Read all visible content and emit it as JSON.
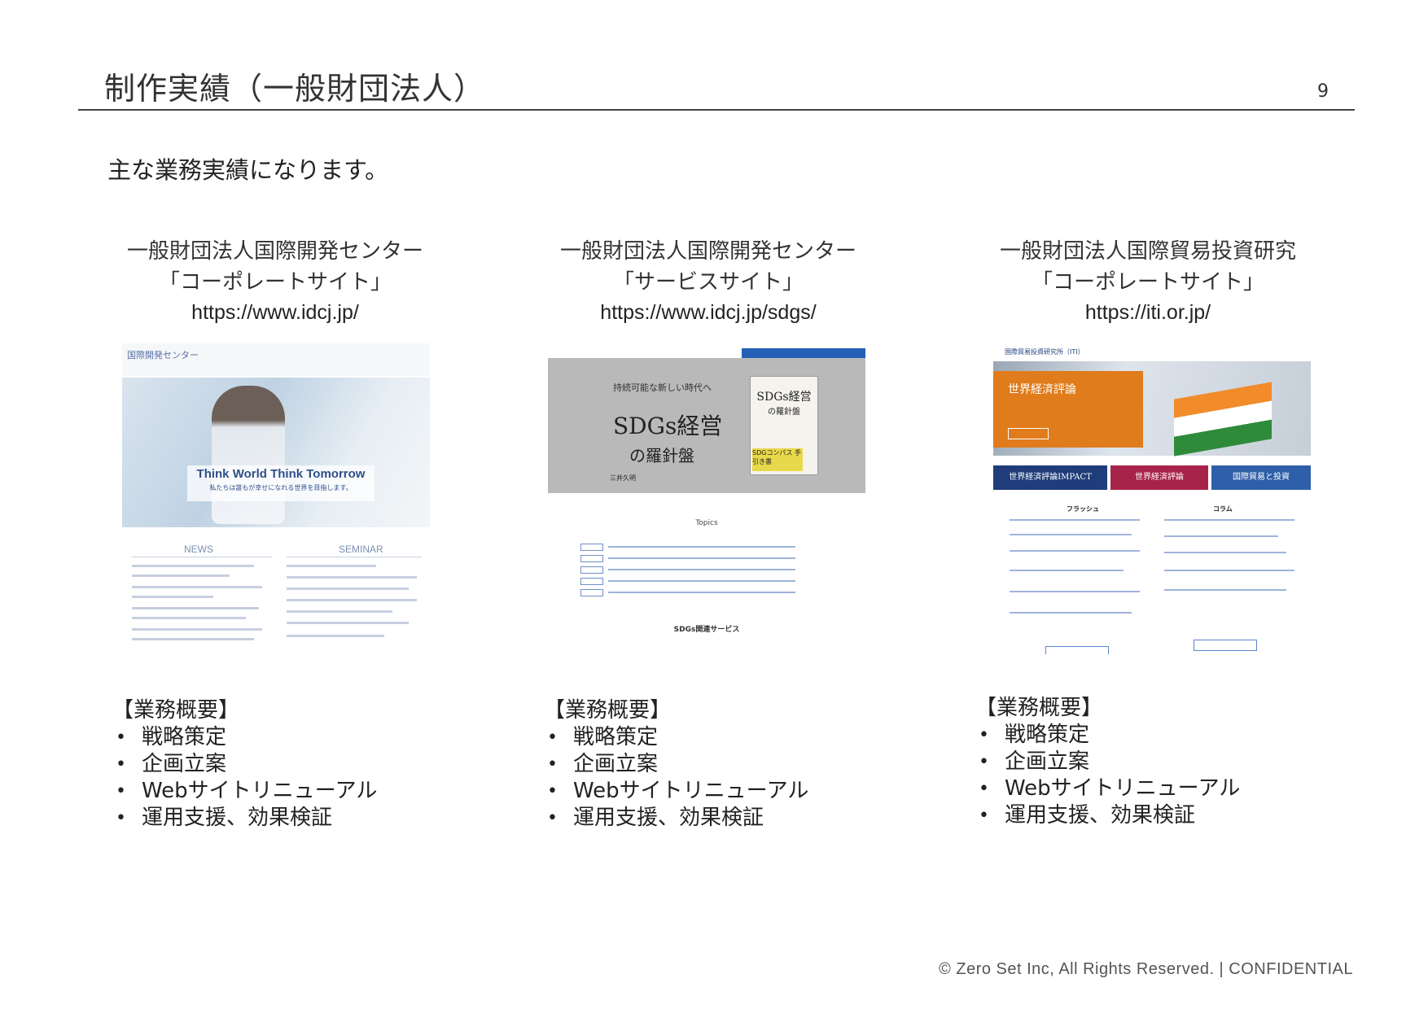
{
  "header": {
    "title": "制作実績（一般財団法人）",
    "page_number": "9"
  },
  "lead": "主な業務実績になります。",
  "projects": [
    {
      "name": "一般財団法人国際開発センター",
      "type": "「コーポレートサイト」",
      "url": "https://www.idcj.jp/",
      "screenshot": {
        "logo": "国際開発センター",
        "hero_title": "Think World Think Tomorrow",
        "hero_subtitle": "私たちは誰もが幸せになれる世界を目指します。",
        "news_label": "NEWS",
        "seminar_label": "SEMINAR"
      }
    },
    {
      "name": "一般財団法人国際開発センター",
      "type": "「サービスサイト」",
      "url": "https://www.idcj.jp/sdgs/",
      "screenshot": {
        "banner_lead": "持続可能な新しい時代へ",
        "banner_title": "SDGs経営",
        "banner_sub": "の羅針盤",
        "banner_author": "三井久明",
        "book_title": "SDGs経営",
        "book_sub": "の羅針盤",
        "book_badge": "SDGコンパス 手引き書",
        "topics_label": "Topics",
        "services_label": "SDGs関連サービス"
      }
    },
    {
      "name": "一般財団法人国際貿易投資研究",
      "type": "「コーポレートサイト」",
      "url": "https://iti.or.jp/",
      "screenshot": {
        "logo": "国際貿易投資研究所（ITI）",
        "hero_title": "世界経済評論",
        "strip": [
          "世界経済評論IMPACT",
          "世界経済評論",
          "国際貿易と投資"
        ],
        "flash_label": "フラッシュ",
        "column_label": "コラム"
      }
    }
  ],
  "summary": {
    "heading": "【業務概要】",
    "items": [
      "戦略策定",
      "企画立案",
      "Webサイトリニューアル",
      "運用支援、効果検証"
    ]
  },
  "footer": "© Zero Set Inc, All Rights Reserved. | CONFIDENTIAL",
  "colors": {
    "accent_blue": "#2461b6",
    "orange": "#e07c1b",
    "rule": "#444444"
  }
}
